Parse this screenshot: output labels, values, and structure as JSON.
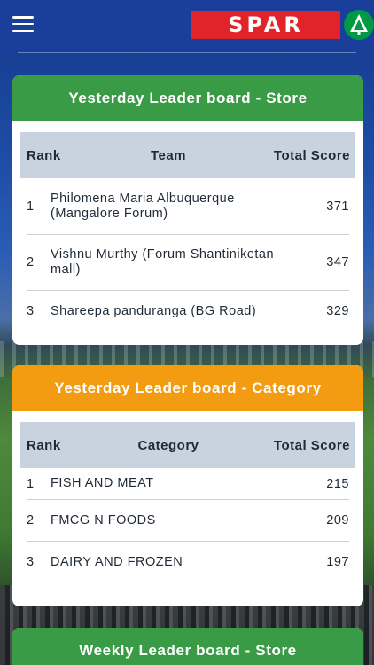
{
  "header": {
    "logo_text": "SPAR",
    "logo_color": "#e2232a",
    "brand_green": "#009a44"
  },
  "store_board": {
    "title": "Yesterday Leader board - Store",
    "columns": [
      "Rank",
      "Team",
      "Total Score"
    ],
    "rows": [
      {
        "rank": "1",
        "team": "Philomena Maria Albuquerque (Mangalore Forum)",
        "score": "371"
      },
      {
        "rank": "2",
        "team": "Vishnu Murthy (Forum Shantiniketan mall)",
        "score": "347"
      },
      {
        "rank": "3",
        "team": "Shareepa panduranga (BG Road)",
        "score": "329"
      }
    ]
  },
  "category_board": {
    "title": "Yesterday Leader board - Category",
    "columns": [
      "Rank",
      "Category",
      "Total Score"
    ],
    "rows": [
      {
        "rank": "1",
        "category": "FISH AND MEAT",
        "score": "215"
      },
      {
        "rank": "2",
        "category": "FMCG N FOODS",
        "score": "209"
      },
      {
        "rank": "3",
        "category": "DAIRY AND FROZEN",
        "score": "197"
      }
    ]
  },
  "weekly_board": {
    "title": "Weekly Leader board - Store"
  },
  "colors": {
    "header_green": "#3a9b47",
    "header_orange": "#f39c12",
    "table_head": "#c8d3df"
  }
}
